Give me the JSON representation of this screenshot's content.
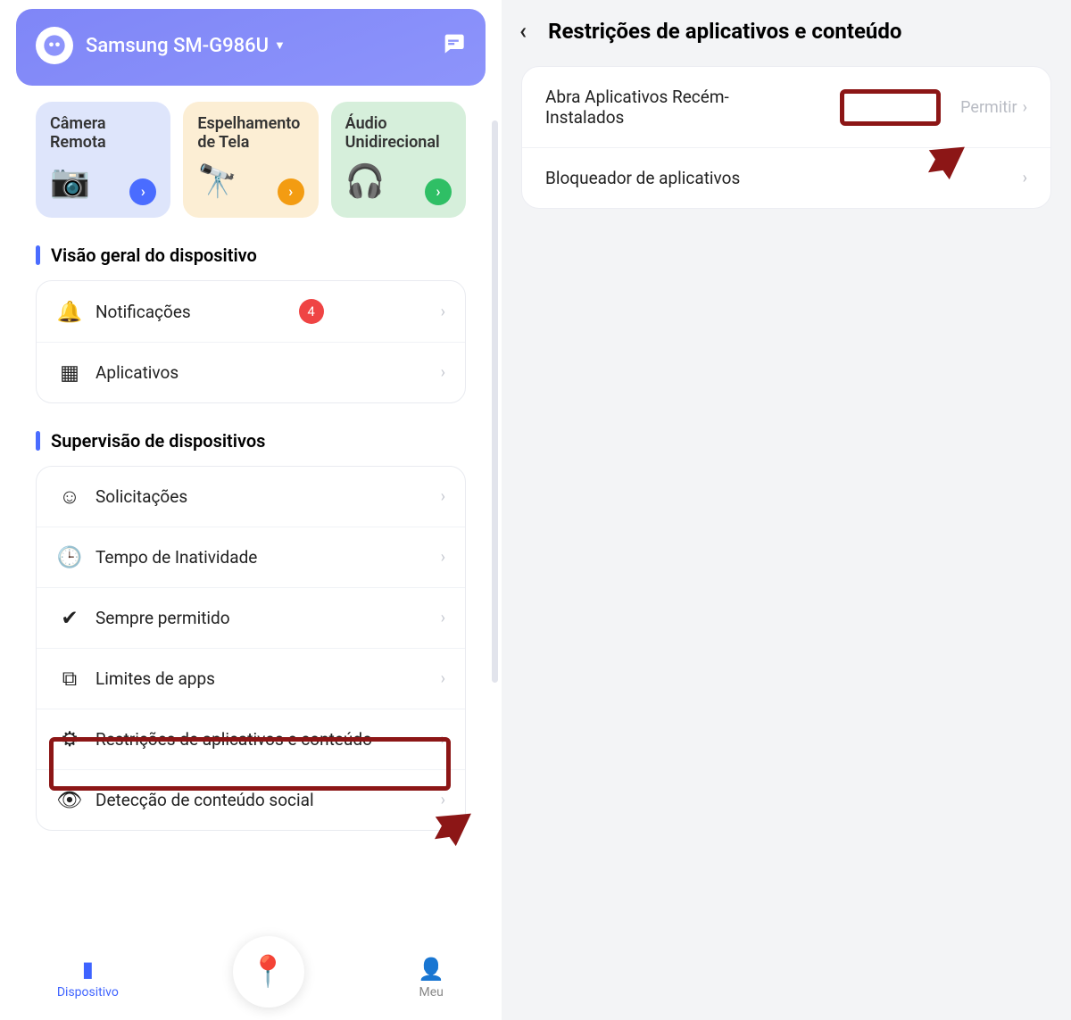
{
  "header": {
    "device_name": "Samsung SM-G986U"
  },
  "tools": [
    {
      "label": "Câmera Remota",
      "bg": "blue",
      "emoji": "📷"
    },
    {
      "label": "Espelhamento de Tela",
      "bg": "yellow",
      "emoji": "🔭"
    },
    {
      "label": "Áudio Unidirecional",
      "bg": "green",
      "emoji": "🎧"
    }
  ],
  "sections": {
    "overview_title": "Visão geral do dispositivo",
    "overview_items": [
      {
        "label": "Notificações",
        "icon": "🔔",
        "badge": "4"
      },
      {
        "label": "Aplicativos",
        "icon": "▦"
      }
    ],
    "supervision_title": "Supervisão de dispositivos",
    "supervision_items": [
      {
        "label": "Solicitações",
        "icon": "☺"
      },
      {
        "label": "Tempo de Inatividade",
        "icon": "🕒"
      },
      {
        "label": "Sempre permitido",
        "icon": "✔"
      },
      {
        "label": "Limites de apps",
        "icon": "⧉"
      },
      {
        "label": "Restrições de aplicativos e conteúdo",
        "icon": "⚙"
      },
      {
        "label": "Detecção de conteúdo social",
        "icon": "👁"
      }
    ]
  },
  "bottom_nav": {
    "device": "Dispositivo",
    "me": "Meu"
  },
  "right": {
    "title": "Restrições de aplicativos e conteúdo",
    "rows": [
      {
        "label": "Abra Aplicativos Recém-Instalados",
        "value": "Permitir"
      },
      {
        "label": "Bloqueador de aplicativos",
        "value": ""
      }
    ]
  }
}
